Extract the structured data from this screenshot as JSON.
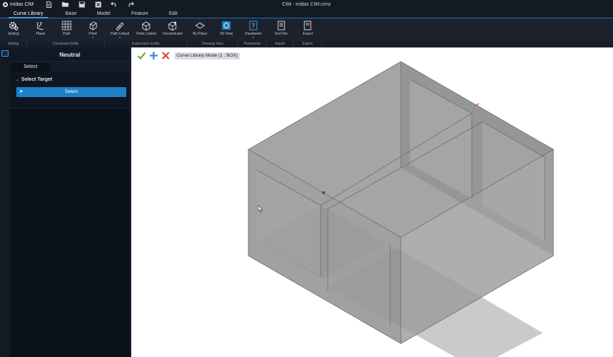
{
  "app": {
    "name": "midas CIM",
    "window_title": "CIM - midas CIM.cimz"
  },
  "quick_access": [
    {
      "name": "new-file-icon",
      "glyph": "▤"
    },
    {
      "name": "open-folder-icon",
      "glyph": "▰"
    },
    {
      "name": "save-icon",
      "glyph": "▣"
    },
    {
      "name": "close-file-icon",
      "glyph": "☒"
    },
    {
      "name": "undo-icon",
      "glyph": "↶"
    },
    {
      "name": "redo-icon",
      "glyph": "↷"
    }
  ],
  "menu_tabs": [
    {
      "label": "Curve Library",
      "active": true
    },
    {
      "label": "Base",
      "active": false
    },
    {
      "label": "Model",
      "active": false
    },
    {
      "label": "Feature",
      "active": false
    },
    {
      "label": "Edit",
      "active": false
    }
  ],
  "ribbon": {
    "buttons": [
      {
        "id": "setting",
        "label": "Setting",
        "icon": "gear-icon",
        "dropdown": false
      },
      {
        "id": "plane",
        "label": "Plane",
        "icon": "plane-icon",
        "dropdown": false
      },
      {
        "id": "path",
        "label": "Path",
        "icon": "grid-path-icon",
        "dropdown": false
      },
      {
        "id": "point",
        "label": "Point",
        "icon": "point-cube-icon",
        "dropdown": true
      },
      {
        "id": "path-linked",
        "label": "Path Linked",
        "icon": "path-linked-icon",
        "dropdown": true
      },
      {
        "id": "point-linked",
        "label": "Point Linked",
        "icon": "point-linked-icon",
        "dropdown": false
      },
      {
        "id": "unconstraint",
        "label": "Unconstraint",
        "icon": "unconstraint-icon",
        "dropdown": false
      },
      {
        "id": "by-plane",
        "label": "By Plane",
        "icon": "by-plane-icon",
        "dropdown": false
      },
      {
        "id": "3d-view",
        "label": "3D View",
        "icon": "3d-view-icon",
        "dropdown": false
      },
      {
        "id": "parameter",
        "label": "Parameter",
        "icon": "parameter-icon",
        "dropdown": true
      },
      {
        "id": "text-file",
        "label": "Text File",
        "icon": "import-text-file-icon",
        "dropdown": false
      },
      {
        "id": "export",
        "label": "Export",
        "icon": "export-icon",
        "dropdown": false
      }
    ],
    "groups": [
      "Setting",
      "Constraint Entity",
      "Expression Entity",
      "Drawing View",
      "Parameter",
      "Import",
      "Export"
    ]
  },
  "panel": {
    "title": "Neutral",
    "tab": "Select",
    "section_title": "Select Target",
    "select_button": "Select"
  },
  "viewport": {
    "mode_label": "Curve Library Mode (1 : BOX)",
    "tools": [
      {
        "name": "confirm-check-icon",
        "color": "#6aa83a"
      },
      {
        "name": "add-plus-icon",
        "color": "#2f87d6"
      },
      {
        "name": "cancel-x-icon",
        "color": "#d9472b"
      }
    ]
  },
  "colors": {
    "accent": "#1e7fc6",
    "active_tab_underline": "#3d9be0",
    "model_fill": "#9a9a9a"
  }
}
